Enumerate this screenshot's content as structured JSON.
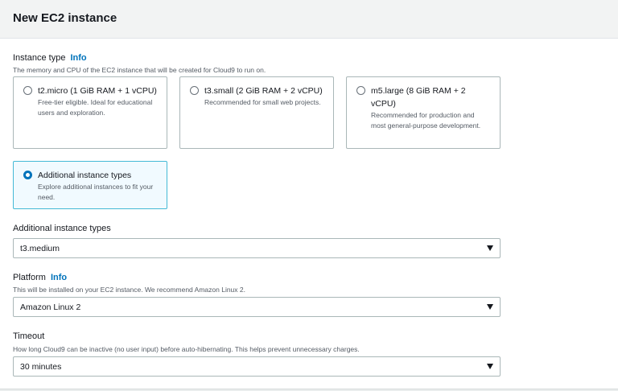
{
  "header": {
    "title": "New EC2 instance"
  },
  "instance_type": {
    "label": "Instance type",
    "info": "Info",
    "description": "The memory and CPU of the EC2 instance that will be created for Cloud9 to run on.",
    "options": [
      {
        "title": "t2.micro (1 GiB RAM + 1 vCPU)",
        "description": "Free-tier eligible. Ideal for educational users and exploration.",
        "selected": false
      },
      {
        "title": "t3.small (2 GiB RAM + 2 vCPU)",
        "description": "Recommended for small web projects.",
        "selected": false
      },
      {
        "title": "m5.large (8 GiB RAM + 2 vCPU)",
        "description": "Recommended for production and most general-purpose development.",
        "selected": false
      },
      {
        "title": "Additional instance types",
        "description": "Explore additional instances to fit your need.",
        "selected": true
      }
    ]
  },
  "additional": {
    "label": "Additional instance types",
    "value": "t3.medium"
  },
  "platform": {
    "label": "Platform",
    "info": "Info",
    "description": "This will be installed on your EC2 instance. We recommend Amazon Linux 2.",
    "value": "Amazon Linux 2"
  },
  "timeout": {
    "label": "Timeout",
    "description": "How long Cloud9 can be inactive (no user input) before auto-hibernating. This helps prevent unnecessary charges.",
    "value": "30 minutes"
  }
}
